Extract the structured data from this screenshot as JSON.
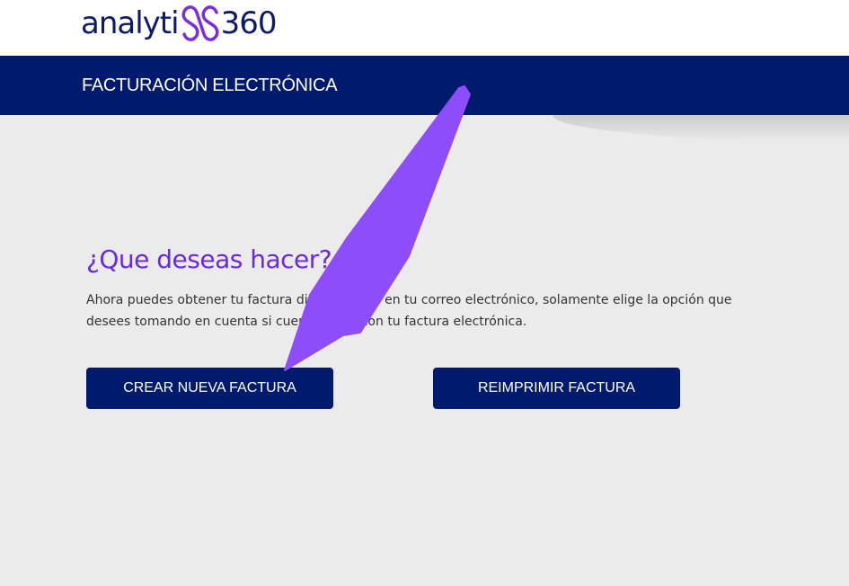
{
  "header": {
    "logo_prefix": "analyti",
    "logo_suffix": "360",
    "logo_icon": "double-loop-logo-icon"
  },
  "banner": {
    "title": "FACTURACIÓN ELECTRÓNICA"
  },
  "main": {
    "heading": "¿Que deseas hacer?",
    "description": "Ahora puedes obtener tu factura directamente en tu correo electrónico, solamente elige la opción que desees tomando en cuenta si cuentas o no con tu factura electrónica.",
    "buttons": {
      "create_label": "CREAR NUEVA FACTURA",
      "reprint_label": "REIMPRIMIR FACTURA"
    }
  },
  "annotation": {
    "arrow_icon": "purple-pointer-arrow-icon"
  },
  "colors": {
    "navy": "#001a6e",
    "accent_purple": "#6a2bdc",
    "arrow_purple": "#8e4dfa",
    "background": "#ebebeb"
  }
}
